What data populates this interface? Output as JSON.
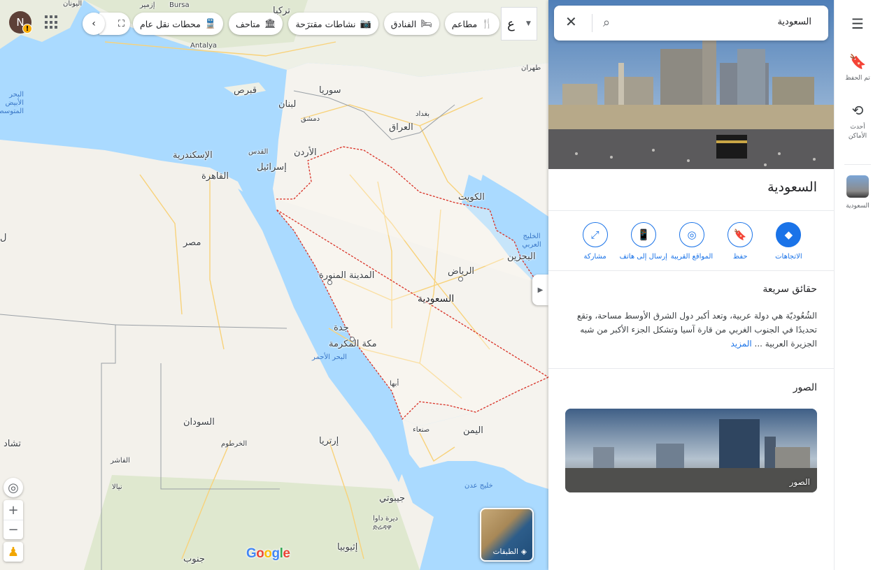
{
  "header": {
    "avatar_initial": "N",
    "avatar_badge": "!",
    "lang_key": "ع",
    "nav_prev": "‹",
    "chip_partial_icon": "ticket-icon"
  },
  "chips": [
    {
      "label": "مطاعم",
      "icon": "🍴"
    },
    {
      "label": "الفنادق",
      "icon": "🛏"
    },
    {
      "label": "نشاطات مقترَحة",
      "icon": "📷"
    },
    {
      "label": "متاحف",
      "icon": "🏛"
    },
    {
      "label": "محطات نقل عام",
      "icon": "🚆"
    }
  ],
  "map_labels": {
    "saudi": "السعودية",
    "riyadh": "الرياض",
    "madinah": "المدينة المنورة",
    "makkah": "مكة المكرمة",
    "jeddah": "جدة",
    "abha": "أبها",
    "kuwait": "الكويت",
    "bahrain": "البحرين",
    "iraq": "العراق",
    "baghdad": "بغداد",
    "syria": "سوريا",
    "damascus": "دمشق",
    "lebanon": "لبنان",
    "jordan": "الأردن",
    "israel": "إسرائيل",
    "jerusalem": "القدس",
    "cyprus": "قبرص",
    "turkey": "تركيا",
    "bursa": "Bursa",
    "antalya": "Antalya",
    "izmir": "إزمير",
    "greece": "اليونان",
    "tehran": "طهران",
    "egypt": "مصر",
    "cairo": "القاهرة",
    "alexandria": "الإسكندرية",
    "sudan": "السودان",
    "khartoum": "الخرطوم",
    "eritrea": "إرتريا",
    "yemen": "اليمن",
    "sanaa": "صنعاء",
    "djibouti": "جيبوتي",
    "ethiopia": "إثيوبيا",
    "dire_dawa": "ديرة داوا",
    "dire_dawa_2": "ድሬዳዋ",
    "chad": "تشاد",
    "south_sudan": "جنوب",
    "fasher": "الفاشر",
    "nyala": "نيالا",
    "red_sea": "البحر الأحمر",
    "gulf_aden": "خليج عدن",
    "persian_gulf": "الخليج العربي",
    "med_sea": "البحر الأبيض المتوسط",
    "libya_partial": "ل"
  },
  "map_controls": {
    "zoom_in": "+",
    "zoom_out": "−",
    "layers_label": "الطبقات",
    "google": [
      "G",
      "o",
      "o",
      "g",
      "l",
      "e"
    ]
  },
  "panel": {
    "search_query": "السعودية",
    "place_title": "السعودية",
    "actions": [
      {
        "label": "الاتجاهات",
        "icon": "◆"
      },
      {
        "label": "حفظ",
        "icon": "🔖"
      },
      {
        "label": "المواقع القريبة",
        "icon": "◎"
      },
      {
        "label": "إرسال إلى هاتف",
        "icon": "📱"
      },
      {
        "label": "مشاركة",
        "icon": "⤢"
      }
    ],
    "quick_facts_title": "حقائق سريعة",
    "quick_facts_text": "الشُعُوديّة هي دولة عربية، وتعد أكبر دول الشرق الأوسط مساحة، وتقع تحديدًا في الجنوب الغربي من قارة آسيا وتشكل الجزء الأكبر من شبه الجزيرة العربية ...",
    "quick_facts_more": "المزيد",
    "photos_title": "الصور",
    "photo_label": "الصور"
  },
  "rail": {
    "saved": "تم الحفظ",
    "recent": "أحدث الأماكن",
    "recent_place": "السعودية"
  },
  "colors": {
    "accent": "#1a73e8",
    "water": "#aadaff",
    "land": "#f5f3ee",
    "border": "#d93025",
    "roads": "#f8d27a"
  }
}
